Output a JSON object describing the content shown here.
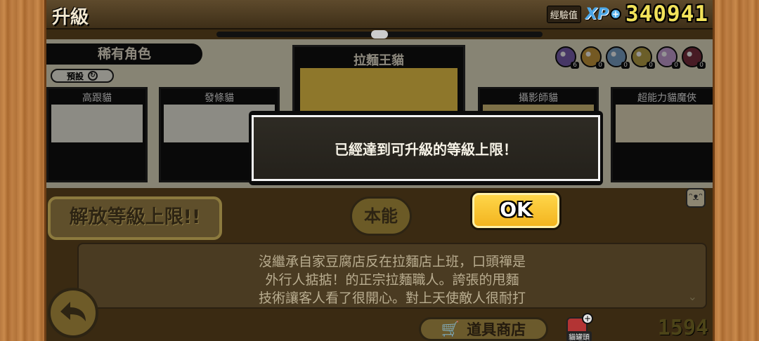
{
  "header": {
    "title": "升級",
    "xp_caption": "經驗值",
    "xp_logo": "XP",
    "xp_value": "340941"
  },
  "category": {
    "label": "稀有角色",
    "preset_label": "預設"
  },
  "orbs": [
    {
      "color": "#7b5fb0",
      "count": "6"
    },
    {
      "color": "#c99a3d",
      "count": "0"
    },
    {
      "color": "#7aa2c8",
      "count": "0"
    },
    {
      "color": "#b9a248",
      "count": "0"
    },
    {
      "color": "#c9a0d6",
      "count": "0"
    },
    {
      "color": "#7a2f3f",
      "count": "0"
    }
  ],
  "cards": [
    {
      "name": "高跟貓"
    },
    {
      "name": "發條貓"
    },
    {
      "name": "攝影師貓"
    },
    {
      "name": "超能力貓魔俠"
    }
  ],
  "featured": {
    "name": "拉麵王貓"
  },
  "buttons": {
    "release": "解放等級上限!!",
    "talent": "本能",
    "ok": "OK",
    "shop": "道具商店"
  },
  "description": {
    "lines": [
      "沒繼承自家豆腐店反在拉麵店上班，口頭禪是",
      "外行人掂掂！的正宗拉麵職人。誇張的甩麵",
      "技術讓客人看了很開心。對上天使敵人很耐打"
    ]
  },
  "footer": {
    "can_label": "貓罐頭",
    "catfood_value": "1594"
  },
  "dialog": {
    "message": "已經達到可升級的等級上限！"
  }
}
